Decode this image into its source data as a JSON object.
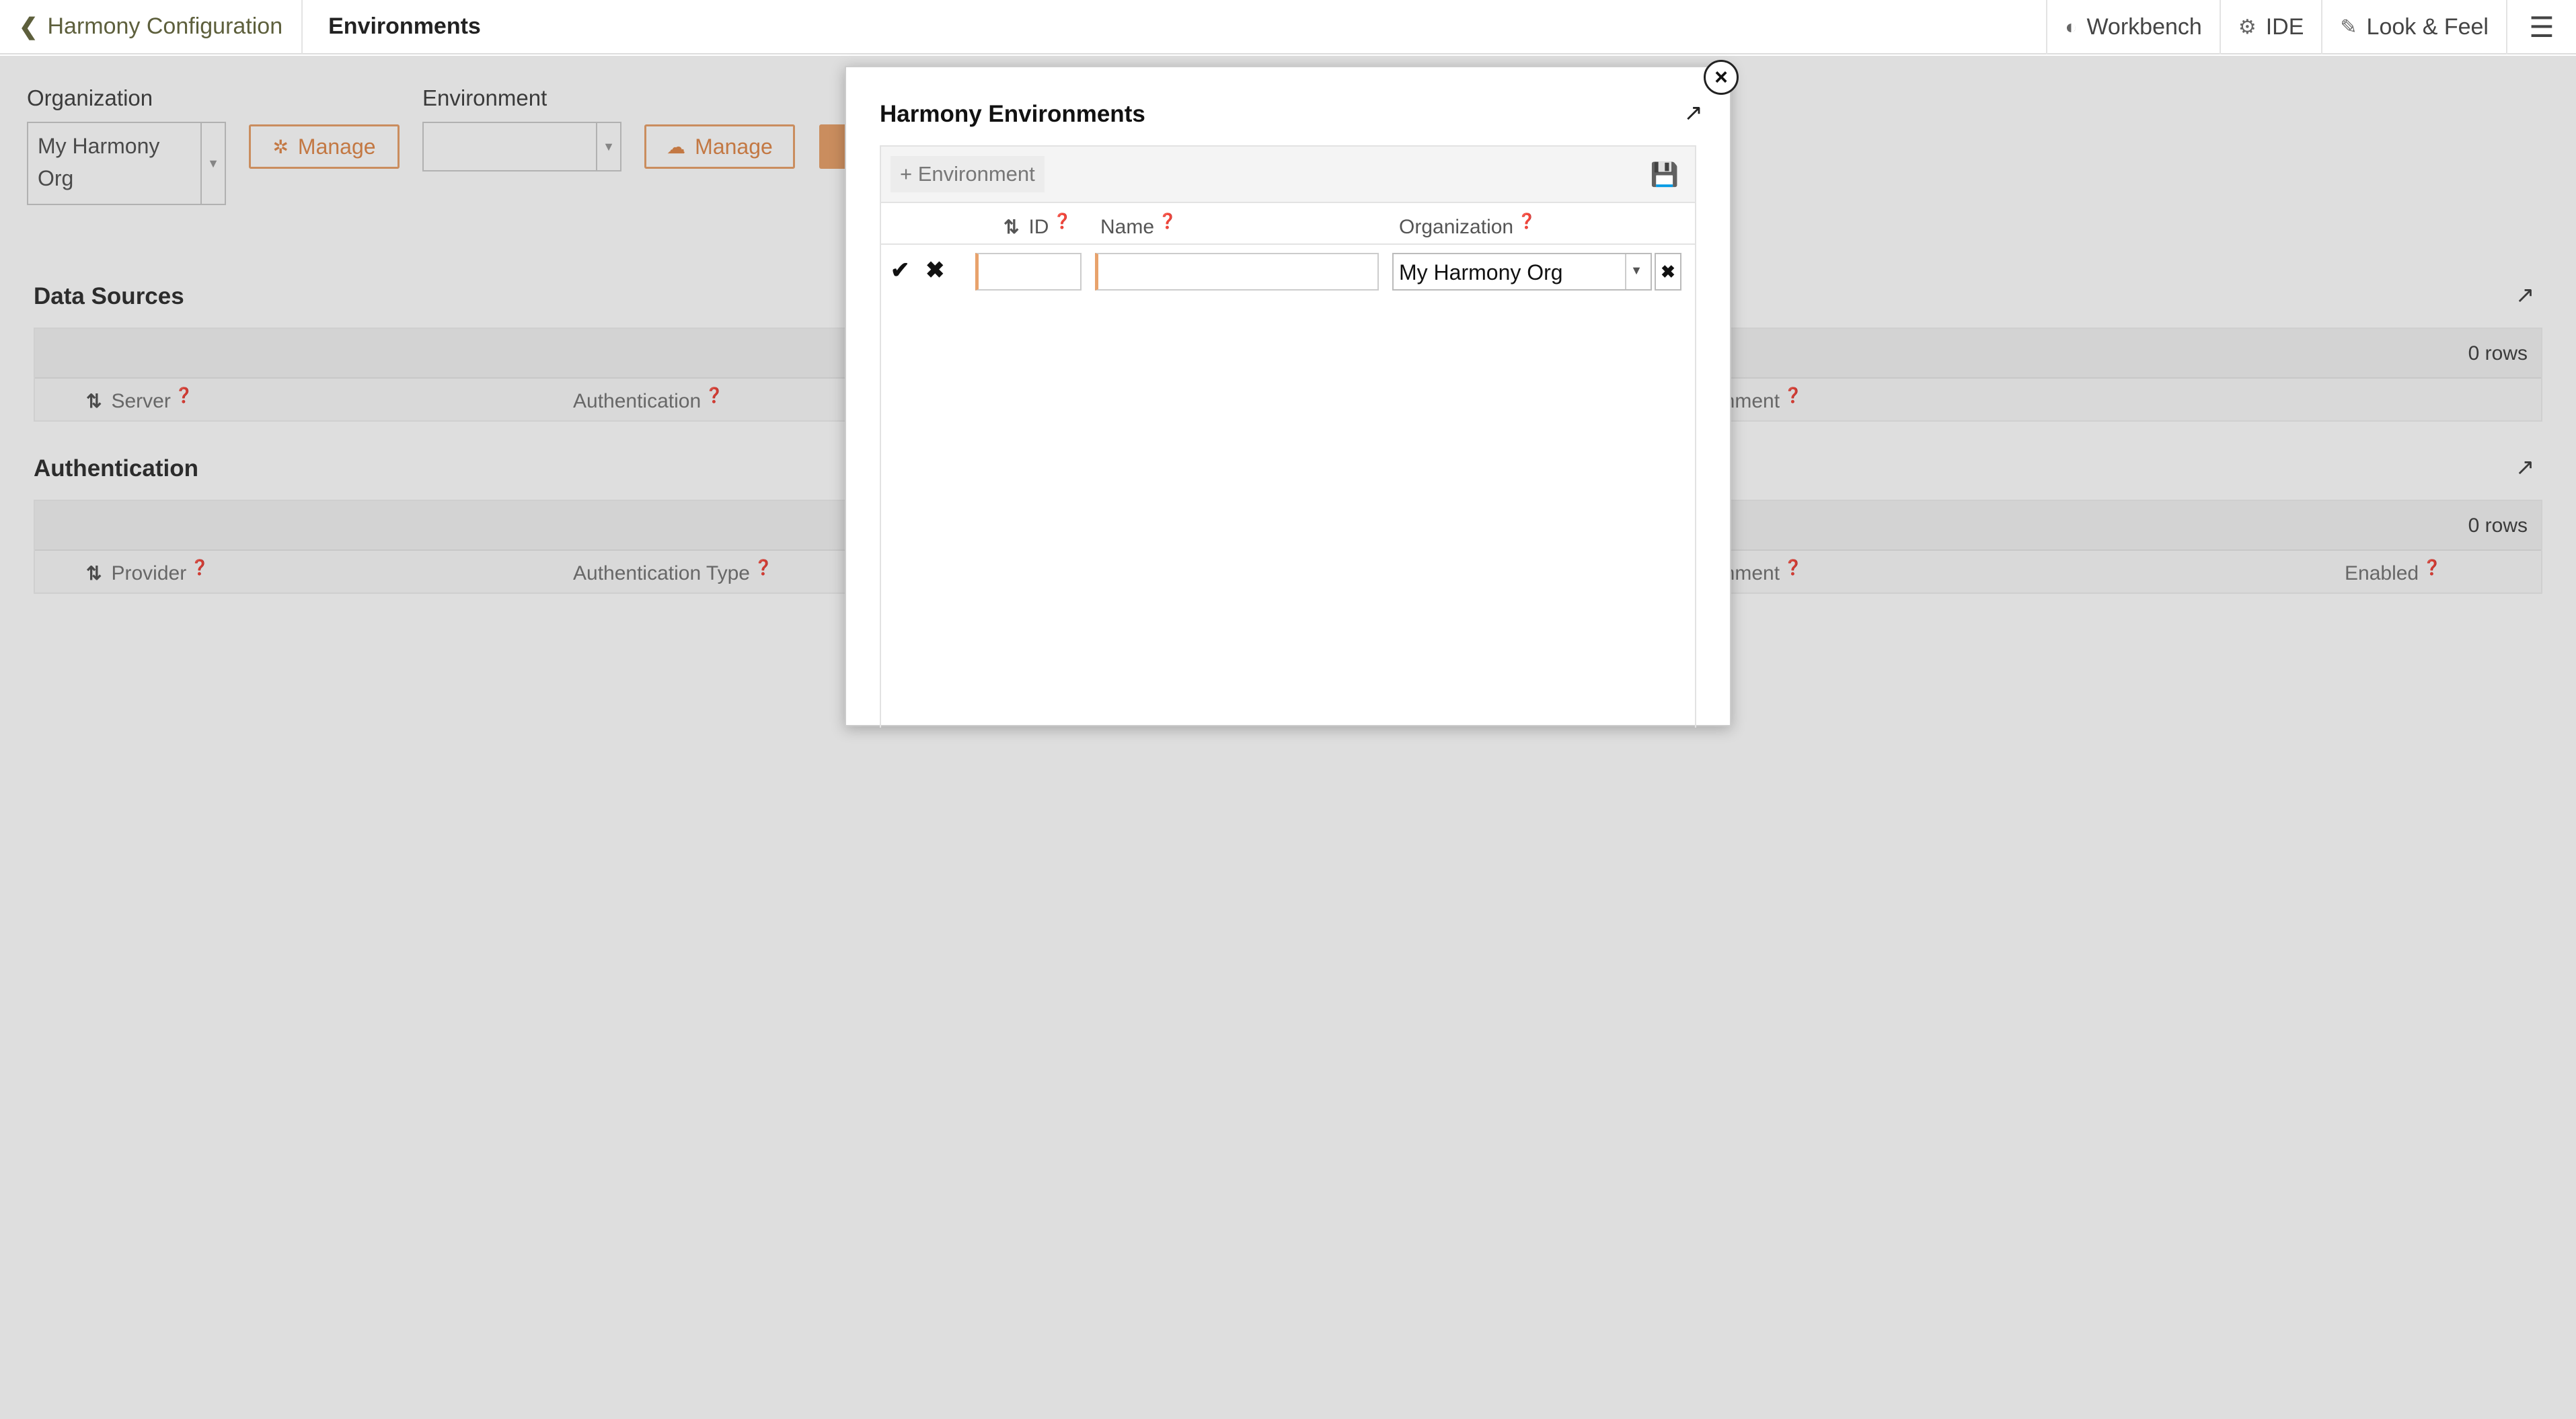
{
  "header": {
    "back_label": "Harmony Configuration",
    "title": "Environments",
    "nav": [
      {
        "label": "Workbench",
        "icon": "workbench-icon"
      },
      {
        "label": "IDE",
        "icon": "gear-icon"
      },
      {
        "label": "Look & Feel",
        "icon": "brush-icon"
      }
    ],
    "menu_icon": "hamburger-menu-icon"
  },
  "filters": {
    "organization_label": "Organization",
    "organization_value": "My Harmony Org",
    "organization_manage": "Manage",
    "environment_label": "Environment",
    "environment_value": "",
    "environment_manage": "Manage"
  },
  "data_sources": {
    "title": "Data Sources",
    "row_count": "0 rows",
    "columns": [
      "Server",
      "Authentication",
      "onment"
    ]
  },
  "authentication": {
    "title": "Authentication",
    "row_count": "0 rows",
    "columns": [
      "Provider",
      "Authentication Type",
      "onment",
      "Enabled"
    ]
  },
  "modal": {
    "title": "Harmony Environments",
    "add_button": "+ Environment",
    "columns": {
      "id": "ID",
      "name": "Name",
      "organization": "Organization"
    },
    "row": {
      "id": "",
      "name": "",
      "organization": "My Harmony Org"
    }
  },
  "colors": {
    "accent": "#e8a26c",
    "back_link": "#5d5f3c"
  }
}
